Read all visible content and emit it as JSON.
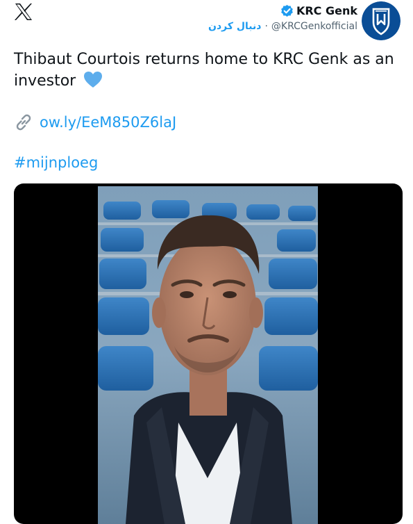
{
  "header": {
    "platform_icon": "x-logo-icon",
    "account_name": "KRC Genk",
    "verified_icon": "verified-badge-icon",
    "follow_label": "دنبال کردن",
    "separator": "·",
    "handle": "@KRCGenkofficial",
    "avatar_icon": "krc-genk-crest-icon"
  },
  "tweet": {
    "text": "Thibaut Courtois returns home to KRC Genk as an investor",
    "emoji": "blue-heart-icon",
    "link_icon": "link-icon",
    "link": "ow.ly/EeM850Z6laJ",
    "hashtag": "#mijnploeg"
  },
  "media": {
    "type": "video-thumbnail"
  },
  "colors": {
    "accent": "#1d9bf0",
    "text": "#0f1419",
    "secondary": "#536471",
    "brand": "#0a4d96"
  }
}
